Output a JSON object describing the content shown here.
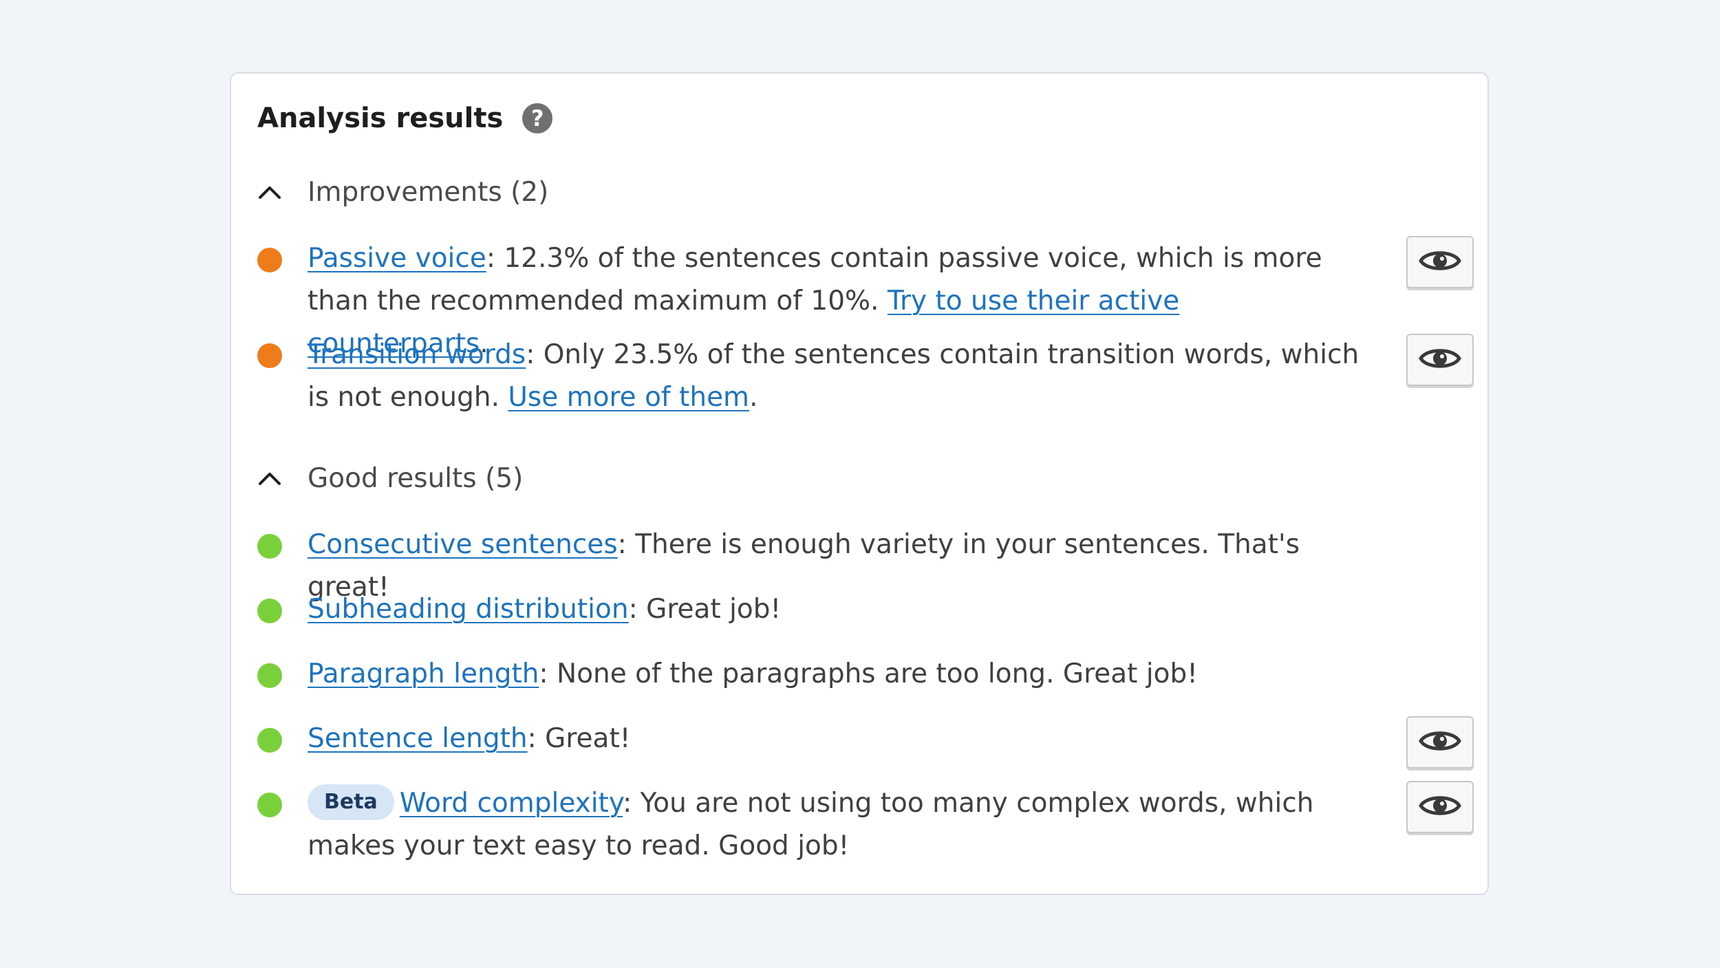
{
  "panel": {
    "title": "Analysis results",
    "help_icon": "question-mark-icon"
  },
  "sections": {
    "improvements": {
      "label": "Improvements (2)",
      "icon": "chevron-up-icon"
    },
    "good": {
      "label": "Good results (5)",
      "icon": "chevron-up-icon"
    }
  },
  "results": {
    "passive_voice": {
      "status": "orange",
      "link": "Passive voice",
      "text": ": 12.3% of the sentences contain passive voice, which is more than the recommended maximum of 10%. ",
      "action_link": "Try to use their active counterparts",
      "end": ".",
      "eye_icon": "eye-icon"
    },
    "transition_words": {
      "status": "orange",
      "link": "Transition words",
      "text": ": Only 23.5% of the sentences contain transition words, which is not enough. ",
      "action_link": "Use more of them",
      "end": ".",
      "eye_icon": "eye-icon"
    },
    "consecutive_sentences": {
      "status": "green",
      "link": "Consecutive sentences",
      "text": ": There is enough variety in your sentences. That's great!"
    },
    "subheading_distribution": {
      "status": "green",
      "link": "Subheading distribution",
      "text": ": Great job!"
    },
    "paragraph_length": {
      "status": "green",
      "link": "Paragraph length",
      "text": ": None of the paragraphs are too long. Great job!"
    },
    "sentence_length": {
      "status": "green",
      "link": "Sentence length",
      "text": ": Great!",
      "eye_icon": "eye-icon"
    },
    "word_complexity": {
      "status": "green",
      "badge": "Beta",
      "link": "Word complexity",
      "text": ": You are not using too many complex words, which makes your text easy to read. Good job!",
      "eye_icon": "eye-icon"
    }
  },
  "colors": {
    "background": "#f1f4f9",
    "orange": "#ee7c1b",
    "green": "#7ad03a",
    "link": "#1e73be",
    "beta_bg": "#d6e6f7"
  }
}
